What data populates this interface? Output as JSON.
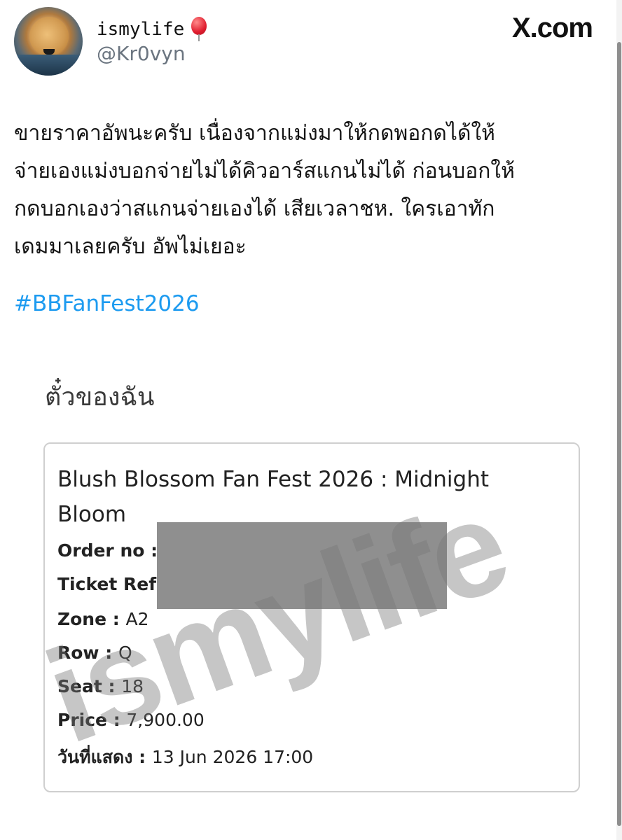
{
  "header": {
    "display_name": "ismylife",
    "handle": "@Kr0vyn",
    "site": "X.com",
    "emoji_icon": "balloon-icon"
  },
  "tweet": {
    "lines": [
      "ขายราคาอัพนะครับ เนื่องจากแม่งมาให้กดพอกดได้ให้",
      "จ่ายเองแม่งบอกจ่ายไม่ได้คิวอาร์สแกนไม่ได้ ก่อนบอกให้",
      "กดบอกเองว่าสแกนจ่ายเองได้ เสียเวลาชห. ใครเอาทัก",
      "เดมมาเลยครับ อัพไม่เยอะ"
    ],
    "hashtag": "#BBFanFest2026"
  },
  "ticket_section": {
    "heading": "ตั๋วของฉัน",
    "event_title_line1": "Blush Blossom Fan Fest 2026 : Midnight",
    "event_title_line2": "Bloom",
    "fields": {
      "order_label": "Order no :",
      "ticket_ref_label": "Ticket Ref",
      "zone_label": "Zone : ",
      "zone_value": "A2",
      "row_label": "Row : ",
      "row_value": "Q",
      "seat_label": "Seat : ",
      "seat_value": "18",
      "price_label": "Price : ",
      "price_value": "7,900.00",
      "date_label": "วันที่แสดง : ",
      "date_value": "13 Jun 2026 17:00"
    }
  },
  "watermark": "ismylife",
  "colors": {
    "hashtag": "#1d9bf0",
    "redaction": "#8f8f8f",
    "handle": "#6b7580"
  }
}
